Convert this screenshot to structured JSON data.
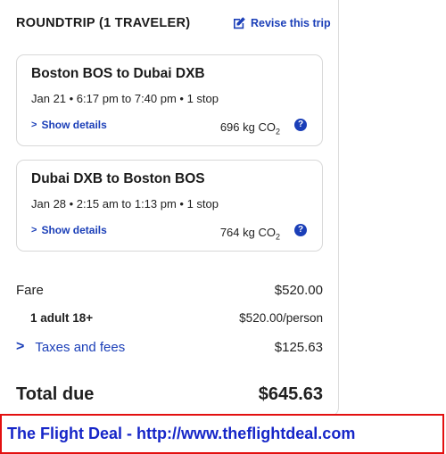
{
  "trip": {
    "header": "ROUNDTRIP (1 TRAVELER)",
    "revise_label": "Revise this trip"
  },
  "flights": [
    {
      "route": "Boston BOS to Dubai DXB",
      "times": "Jan 21 • 6:17 pm to 7:40 pm • 1 stop",
      "details_label": "Show details",
      "co2": "696 kg CO",
      "co2_sub": "2",
      "help": "?"
    },
    {
      "route": "Dubai DXB to Boston BOS",
      "times": "Jan 28 • 2:15 am to 1:13 pm • 1 stop",
      "details_label": "Show details",
      "co2": "764 kg CO",
      "co2_sub": "2",
      "help": "?"
    }
  ],
  "price": {
    "fare_label": "Fare",
    "fare_value": "$520.00",
    "adult_label": "1 adult 18+",
    "adult_value": "$520.00/person",
    "taxes_label": "Taxes and fees",
    "taxes_value": "$125.63",
    "total_label": "Total due",
    "total_value": "$645.63"
  },
  "banner": {
    "text": "The Flight Deal - http://www.theflightdeal.com"
  },
  "colors": {
    "accent": "#1b3fb8",
    "banner_border": "#e31010",
    "banner_text": "#1626c8"
  }
}
